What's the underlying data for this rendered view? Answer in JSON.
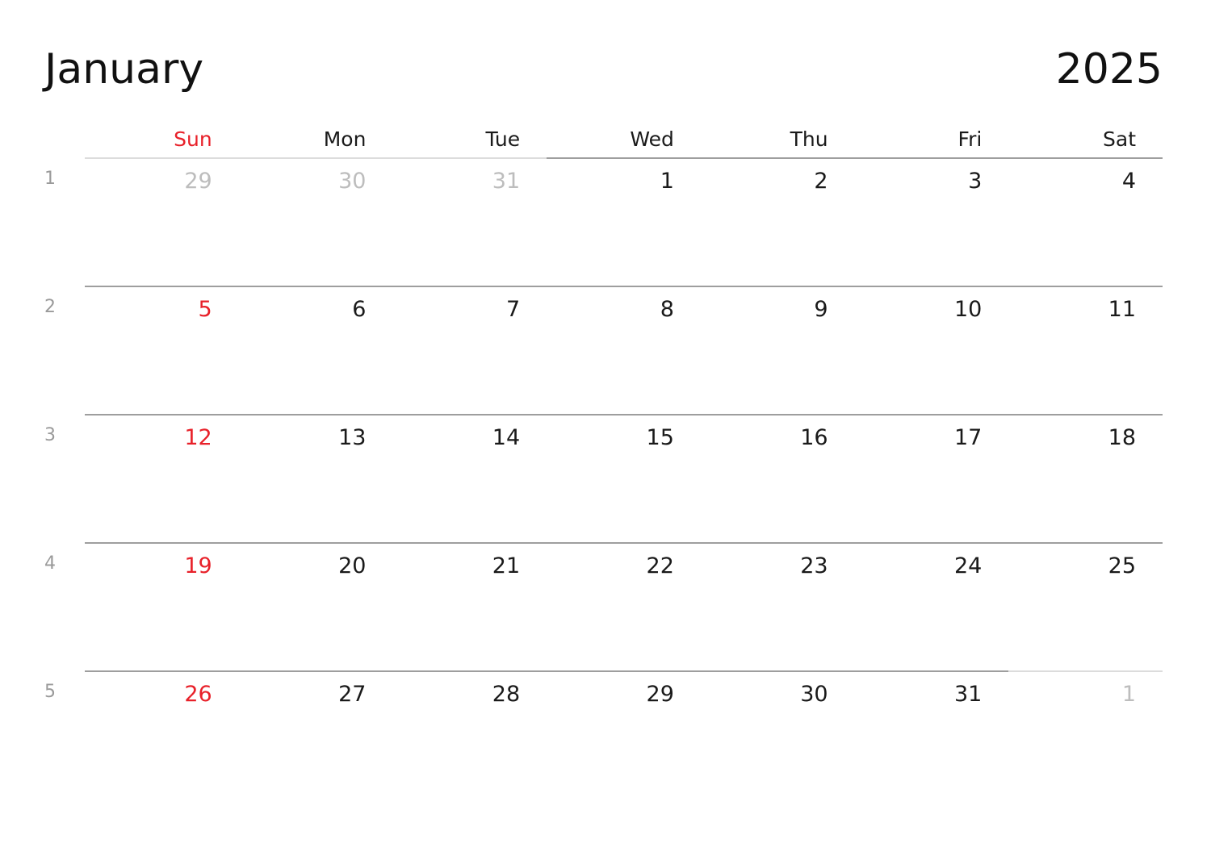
{
  "header": {
    "month": "January",
    "year": "2025"
  },
  "colors": {
    "sunday_red": "#e8212a",
    "weekday_text": "#1a1a1a",
    "other_month_text": "#bdbdbd",
    "week_number_text": "#9a9a9a",
    "rule_dark": "#9e9e9e",
    "rule_light": "#dcdcdc",
    "background": "#ffffff"
  },
  "weekday_headers": [
    {
      "label": "Sun",
      "sunday": true
    },
    {
      "label": "Mon",
      "sunday": false
    },
    {
      "label": "Tue",
      "sunday": false
    },
    {
      "label": "Wed",
      "sunday": false
    },
    {
      "label": "Thu",
      "sunday": false
    },
    {
      "label": "Fri",
      "sunday": false
    },
    {
      "label": "Sat",
      "sunday": false
    }
  ],
  "weeks": [
    {
      "week_number": "1",
      "days": [
        {
          "date": "29",
          "other_month": true,
          "sunday": true
        },
        {
          "date": "30",
          "other_month": true,
          "sunday": false
        },
        {
          "date": "31",
          "other_month": true,
          "sunday": false
        },
        {
          "date": "1",
          "other_month": false,
          "sunday": false
        },
        {
          "date": "2",
          "other_month": false,
          "sunday": false
        },
        {
          "date": "3",
          "other_month": false,
          "sunday": false
        },
        {
          "date": "4",
          "other_month": false,
          "sunday": false
        }
      ]
    },
    {
      "week_number": "2",
      "days": [
        {
          "date": "5",
          "other_month": false,
          "sunday": true
        },
        {
          "date": "6",
          "other_month": false,
          "sunday": false
        },
        {
          "date": "7",
          "other_month": false,
          "sunday": false
        },
        {
          "date": "8",
          "other_month": false,
          "sunday": false
        },
        {
          "date": "9",
          "other_month": false,
          "sunday": false
        },
        {
          "date": "10",
          "other_month": false,
          "sunday": false
        },
        {
          "date": "11",
          "other_month": false,
          "sunday": false
        }
      ]
    },
    {
      "week_number": "3",
      "days": [
        {
          "date": "12",
          "other_month": false,
          "sunday": true
        },
        {
          "date": "13",
          "other_month": false,
          "sunday": false
        },
        {
          "date": "14",
          "other_month": false,
          "sunday": false
        },
        {
          "date": "15",
          "other_month": false,
          "sunday": false
        },
        {
          "date": "16",
          "other_month": false,
          "sunday": false
        },
        {
          "date": "17",
          "other_month": false,
          "sunday": false
        },
        {
          "date": "18",
          "other_month": false,
          "sunday": false
        }
      ]
    },
    {
      "week_number": "4",
      "days": [
        {
          "date": "19",
          "other_month": false,
          "sunday": true
        },
        {
          "date": "20",
          "other_month": false,
          "sunday": false
        },
        {
          "date": "21",
          "other_month": false,
          "sunday": false
        },
        {
          "date": "22",
          "other_month": false,
          "sunday": false
        },
        {
          "date": "23",
          "other_month": false,
          "sunday": false
        },
        {
          "date": "24",
          "other_month": false,
          "sunday": false
        },
        {
          "date": "25",
          "other_month": false,
          "sunday": false
        }
      ]
    },
    {
      "week_number": "5",
      "days": [
        {
          "date": "26",
          "other_month": false,
          "sunday": true
        },
        {
          "date": "27",
          "other_month": false,
          "sunday": false
        },
        {
          "date": "28",
          "other_month": false,
          "sunday": false
        },
        {
          "date": "29",
          "other_month": false,
          "sunday": false
        },
        {
          "date": "30",
          "other_month": false,
          "sunday": false
        },
        {
          "date": "31",
          "other_month": false,
          "sunday": false
        },
        {
          "date": "1",
          "other_month": true,
          "sunday": false
        }
      ]
    }
  ]
}
